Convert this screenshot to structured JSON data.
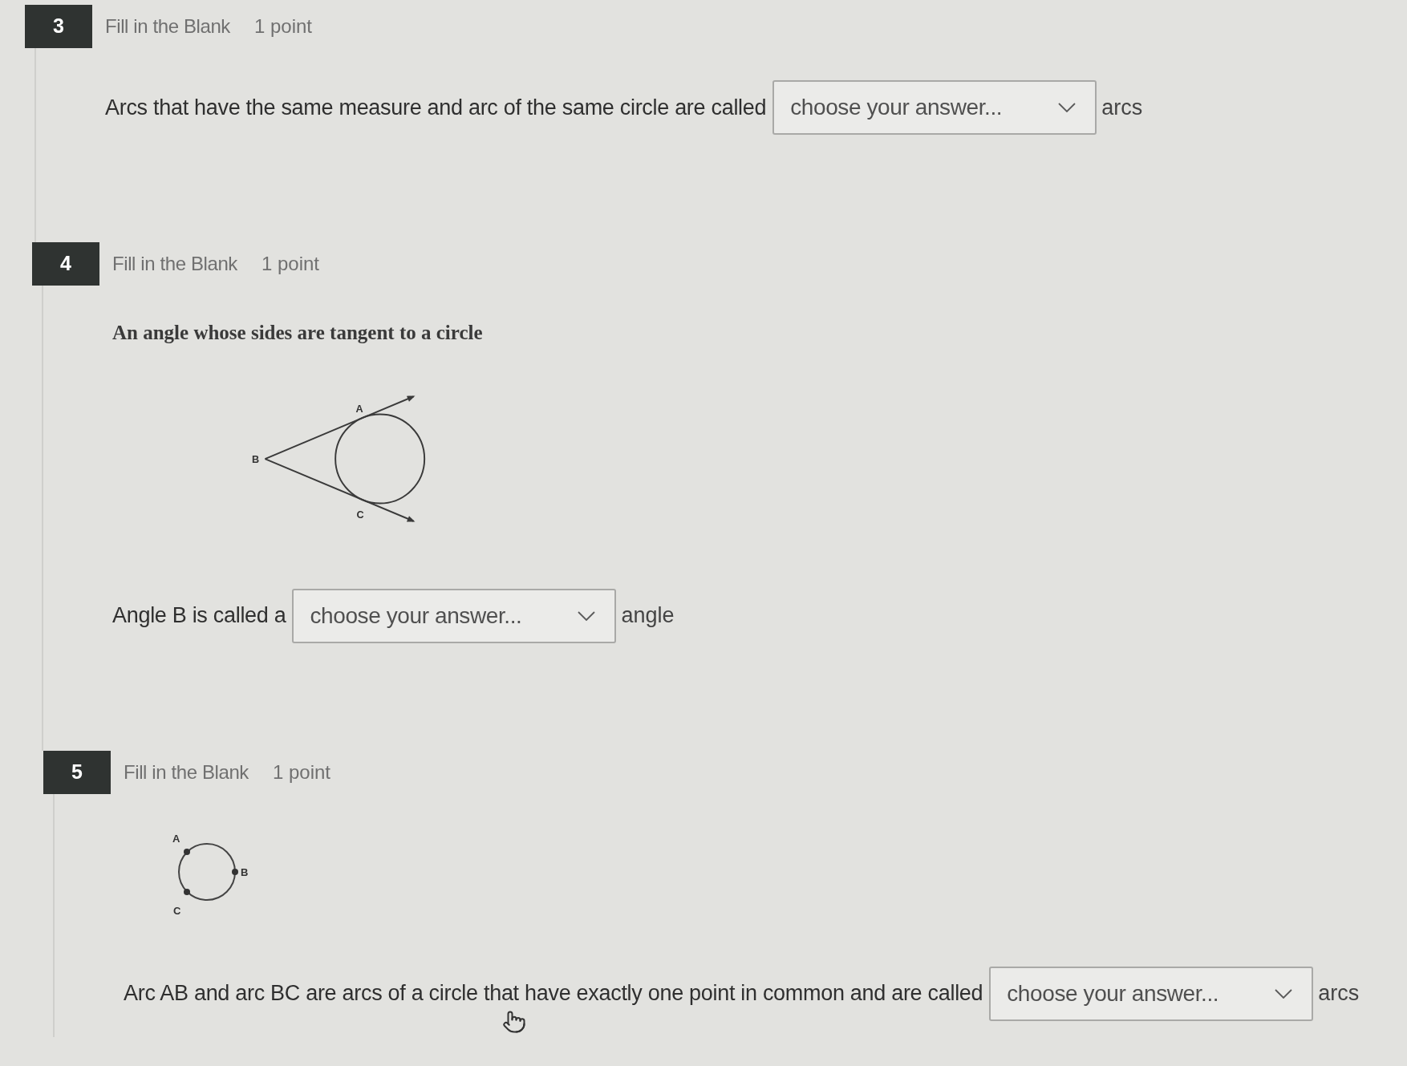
{
  "questions": [
    {
      "number": "3",
      "type": "Fill in the Blank",
      "points": "1 point",
      "content": [
        {
          "kind": "blank",
          "before": "Arcs that have the same measure and arc of the same circle are called",
          "placeholder": "choose your answer...",
          "after": "arcs"
        }
      ]
    },
    {
      "number": "4",
      "type": "Fill in the Blank",
      "points": "1 point",
      "content": [
        {
          "kind": "prompt",
          "text": "An angle whose sides are tangent to a circle"
        },
        {
          "kind": "tangent_figure",
          "labels": [
            "A",
            "B",
            "C"
          ]
        },
        {
          "kind": "blank",
          "before": "Angle B is called a",
          "placeholder": "choose your answer...",
          "after": "angle"
        }
      ]
    },
    {
      "number": "5",
      "type": "Fill in the Blank",
      "points": "1 point",
      "content": [
        {
          "kind": "circle_figure",
          "labels": [
            "A",
            "B",
            "C"
          ]
        },
        {
          "kind": "blank",
          "before": "Arc AB and arc BC are arcs of a circle that have exactly one point in common and are called",
          "placeholder": "choose your answer...",
          "after": "arcs"
        }
      ]
    }
  ]
}
